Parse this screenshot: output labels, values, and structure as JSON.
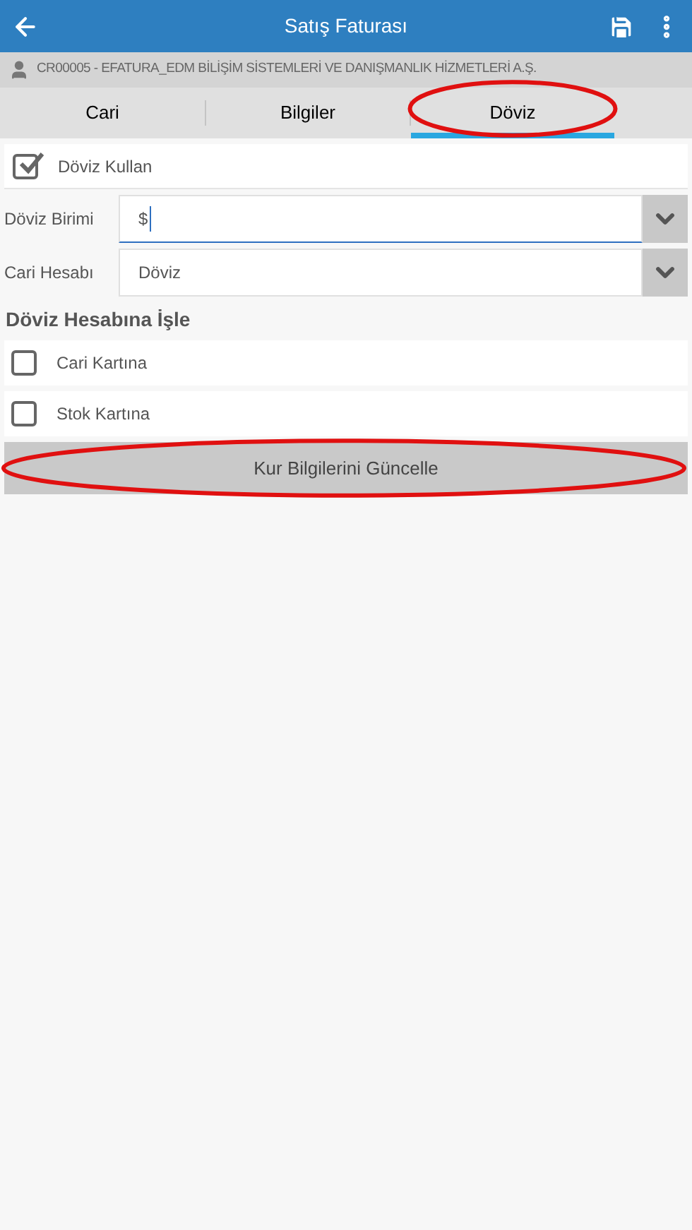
{
  "app_bar": {
    "title": "Satış Faturası"
  },
  "customer": {
    "text": "CR00005 - EFATURA_EDM BİLİŞİM SİSTEMLERİ VE DANIŞMANLIK HİZMETLERİ A.Ş."
  },
  "tabs": [
    {
      "label": "Cari",
      "selected": false,
      "circled": false
    },
    {
      "label": "Bilgiler",
      "selected": false,
      "circled": false
    },
    {
      "label": "Döviz",
      "selected": true,
      "circled": true
    }
  ],
  "use_currency": {
    "label": "Döviz Kullan",
    "checked": true
  },
  "fields": [
    {
      "label": "Döviz Birimi",
      "value": "$",
      "focused": true
    },
    {
      "label": "Cari Hesabı",
      "value": "Döviz",
      "focused": false
    }
  ],
  "section_title": "Döviz Hesabına İşle",
  "options": [
    {
      "label": "Cari Kartına",
      "checked": false
    },
    {
      "label": "Stok Kartına",
      "checked": false
    }
  ],
  "update_button": {
    "label": "Kur Bilgilerini Güncelle",
    "circled": true
  }
}
